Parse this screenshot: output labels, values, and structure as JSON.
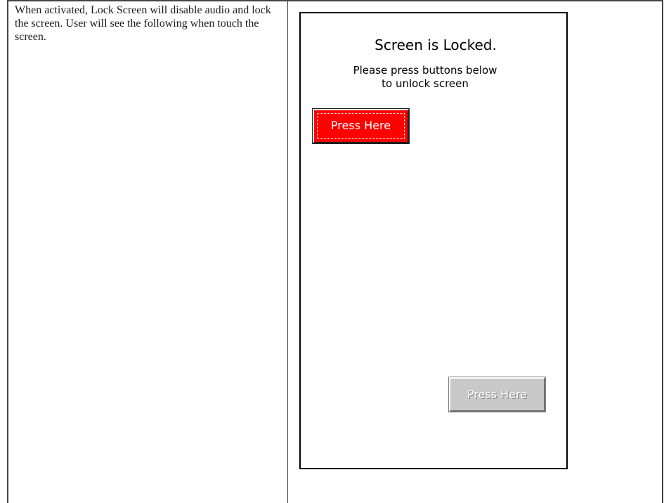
{
  "description": {
    "text": "When activated, Lock Screen will disable audio and lock the screen. User will see the following when touch the screen."
  },
  "lock_screen": {
    "title": "Screen is Locked.",
    "message_line1": "Please press buttons below",
    "message_line2": "to unlock screen",
    "button_primary_label": "Press Here",
    "button_secondary_label": "Press Here"
  },
  "colors": {
    "primary_button": "#ff0000",
    "secondary_button": "#c8c8c8",
    "background": "#ffffff"
  }
}
